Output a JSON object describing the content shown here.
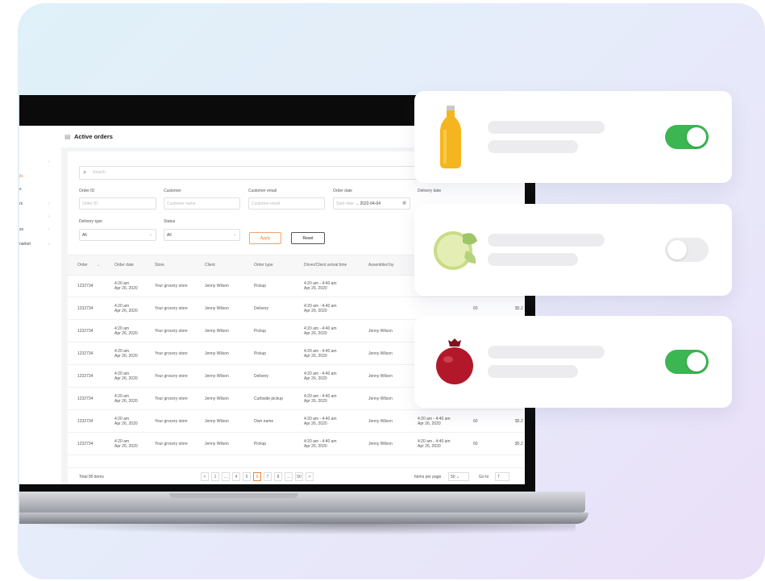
{
  "app": {
    "page_title": "Active orders"
  },
  "sidebar": {
    "items": [
      {
        "label": "ils",
        "active": true
      },
      {
        "label": "s",
        "active": false
      },
      {
        "label": "rs",
        "active": false
      },
      {
        "label": "",
        "active": false
      },
      {
        "label": "ss",
        "active": false
      },
      {
        "label": "narket",
        "active": false
      }
    ]
  },
  "filters": {
    "search_placeholder": "Search",
    "order_id": {
      "label": "Order ID",
      "placeholder": "Order ID"
    },
    "customer": {
      "label": "Customer",
      "placeholder": "Customer name"
    },
    "customer_email": {
      "label": "Customer email",
      "placeholder": "Customer email"
    },
    "order_date": {
      "label": "Order date",
      "start_placeholder": "Start date",
      "arrow": "→",
      "end_value": "2022-04-04"
    },
    "delivery_date": {
      "label": "Delivery date"
    },
    "delivery_type": {
      "label": "Delivery type",
      "value": "All"
    },
    "status": {
      "label": "Status",
      "value": "All"
    },
    "apply_label": "Apply",
    "reset_label": "Reset"
  },
  "table": {
    "columns": [
      "Order",
      "Order date",
      "Store",
      "Client",
      "Order type",
      "Driver/Client arrival time",
      "Assembled by"
    ],
    "rows": [
      {
        "order": "1232734",
        "date1": "4:20 am",
        "date2": "Apr 26, 2020",
        "store": "Your grocery store",
        "client": "Jenny Wilson",
        "type": "Pickup",
        "arr1": "4:20 am - 4:40 am",
        "arr2": "Apr 26, 2020",
        "assembled": ""
      },
      {
        "order": "1232734",
        "date1": "4:20 am",
        "date2": "Apr 26, 2020",
        "store": "Your grocery store",
        "client": "Jenny Wilson",
        "type": "Delivery",
        "arr1": "4:20 am - 4:40 am",
        "arr2": "Apr 26, 2020",
        "assembled": ""
      },
      {
        "order": "1232734",
        "date1": "4:20 am",
        "date2": "Apr 26, 2020",
        "store": "Your grocery store",
        "client": "Jenny Wilson",
        "type": "Pickup",
        "arr1": "4:20 am - 4:40 am",
        "arr2": "Apr 26, 2020",
        "assembled": "Jenny Wilson"
      },
      {
        "order": "1232734",
        "date1": "4:20 am",
        "date2": "Apr 26, 2020",
        "store": "Your grocery store",
        "client": "Jenny Wilson",
        "type": "Pickup",
        "arr1": "4:20 am - 4:40 am",
        "arr2": "Apr 26, 2020",
        "assembled": "Jenny Wilson"
      },
      {
        "order": "1232734",
        "date1": "4:20 am",
        "date2": "Apr 26, 2020",
        "store": "Your grocery store",
        "client": "Jenny Wilson",
        "type": "Delivery",
        "arr1": "4:20 am - 4:40 am",
        "arr2": "Apr 26, 2020",
        "assembled": "Jenny Wilson"
      },
      {
        "order": "1232734",
        "date1": "4:20 am",
        "date2": "Apr 26, 2020",
        "store": "Your grocery store",
        "client": "Jenny Wilson",
        "type": "Curbside pickup",
        "arr1": "4:20 am - 4:40 am",
        "arr2": "Apr 26, 2020",
        "assembled": "Jenny Wilson"
      },
      {
        "order": "1232734",
        "date1": "4:20 am",
        "date2": "Apr 26, 2020",
        "store": "Your grocery store",
        "client": "Jenny Wilson",
        "type": "Own name",
        "arr1": "4:20 am - 4:40 am",
        "arr2": "Apr 26, 2020",
        "assembled": "Jenny Wilson"
      },
      {
        "order": "1232734",
        "date1": "4:20 am",
        "date2": "Apr 26, 2020",
        "store": "Your grocery store",
        "client": "Jenny Wilson",
        "type": "Pickup",
        "arr1": "4:20 am - 4:40 am",
        "arr2": "Apr 26, 2020",
        "assembled": "Jenny Wilson"
      }
    ],
    "extra": {
      "row2": {
        "val": "60",
        "price": "$5.2"
      },
      "row7": {
        "time1": "4:20 am - 4:40 am",
        "time2": "Apr 26, 2020",
        "val": "60",
        "price": "$5.2"
      },
      "row8": {
        "time1": "4:20 am - 4:40 am",
        "time2": "Apr 26, 2020",
        "val": "60",
        "price": "$5.2"
      },
      "row9": {
        "time1": "4:20 am - 4:40 am"
      }
    }
  },
  "footer": {
    "total": "Total 85 items",
    "pages": [
      "<",
      "1",
      "...",
      "4",
      "5",
      "6",
      "7",
      "8",
      "...",
      "50",
      ">"
    ],
    "active_page": "6",
    "rows_per_page_label": "Items per page",
    "rows_per_page_value": "50",
    "goto_label": "Go to",
    "goto_value": "7"
  },
  "products": [
    {
      "name": "juice-bottle",
      "enabled": true
    },
    {
      "name": "lime",
      "enabled": false
    },
    {
      "name": "pomegranate",
      "enabled": true
    }
  ],
  "colors": {
    "accent": "#e8863a",
    "toggle_on": "#3cb553",
    "toggle_off": "#ececee"
  }
}
